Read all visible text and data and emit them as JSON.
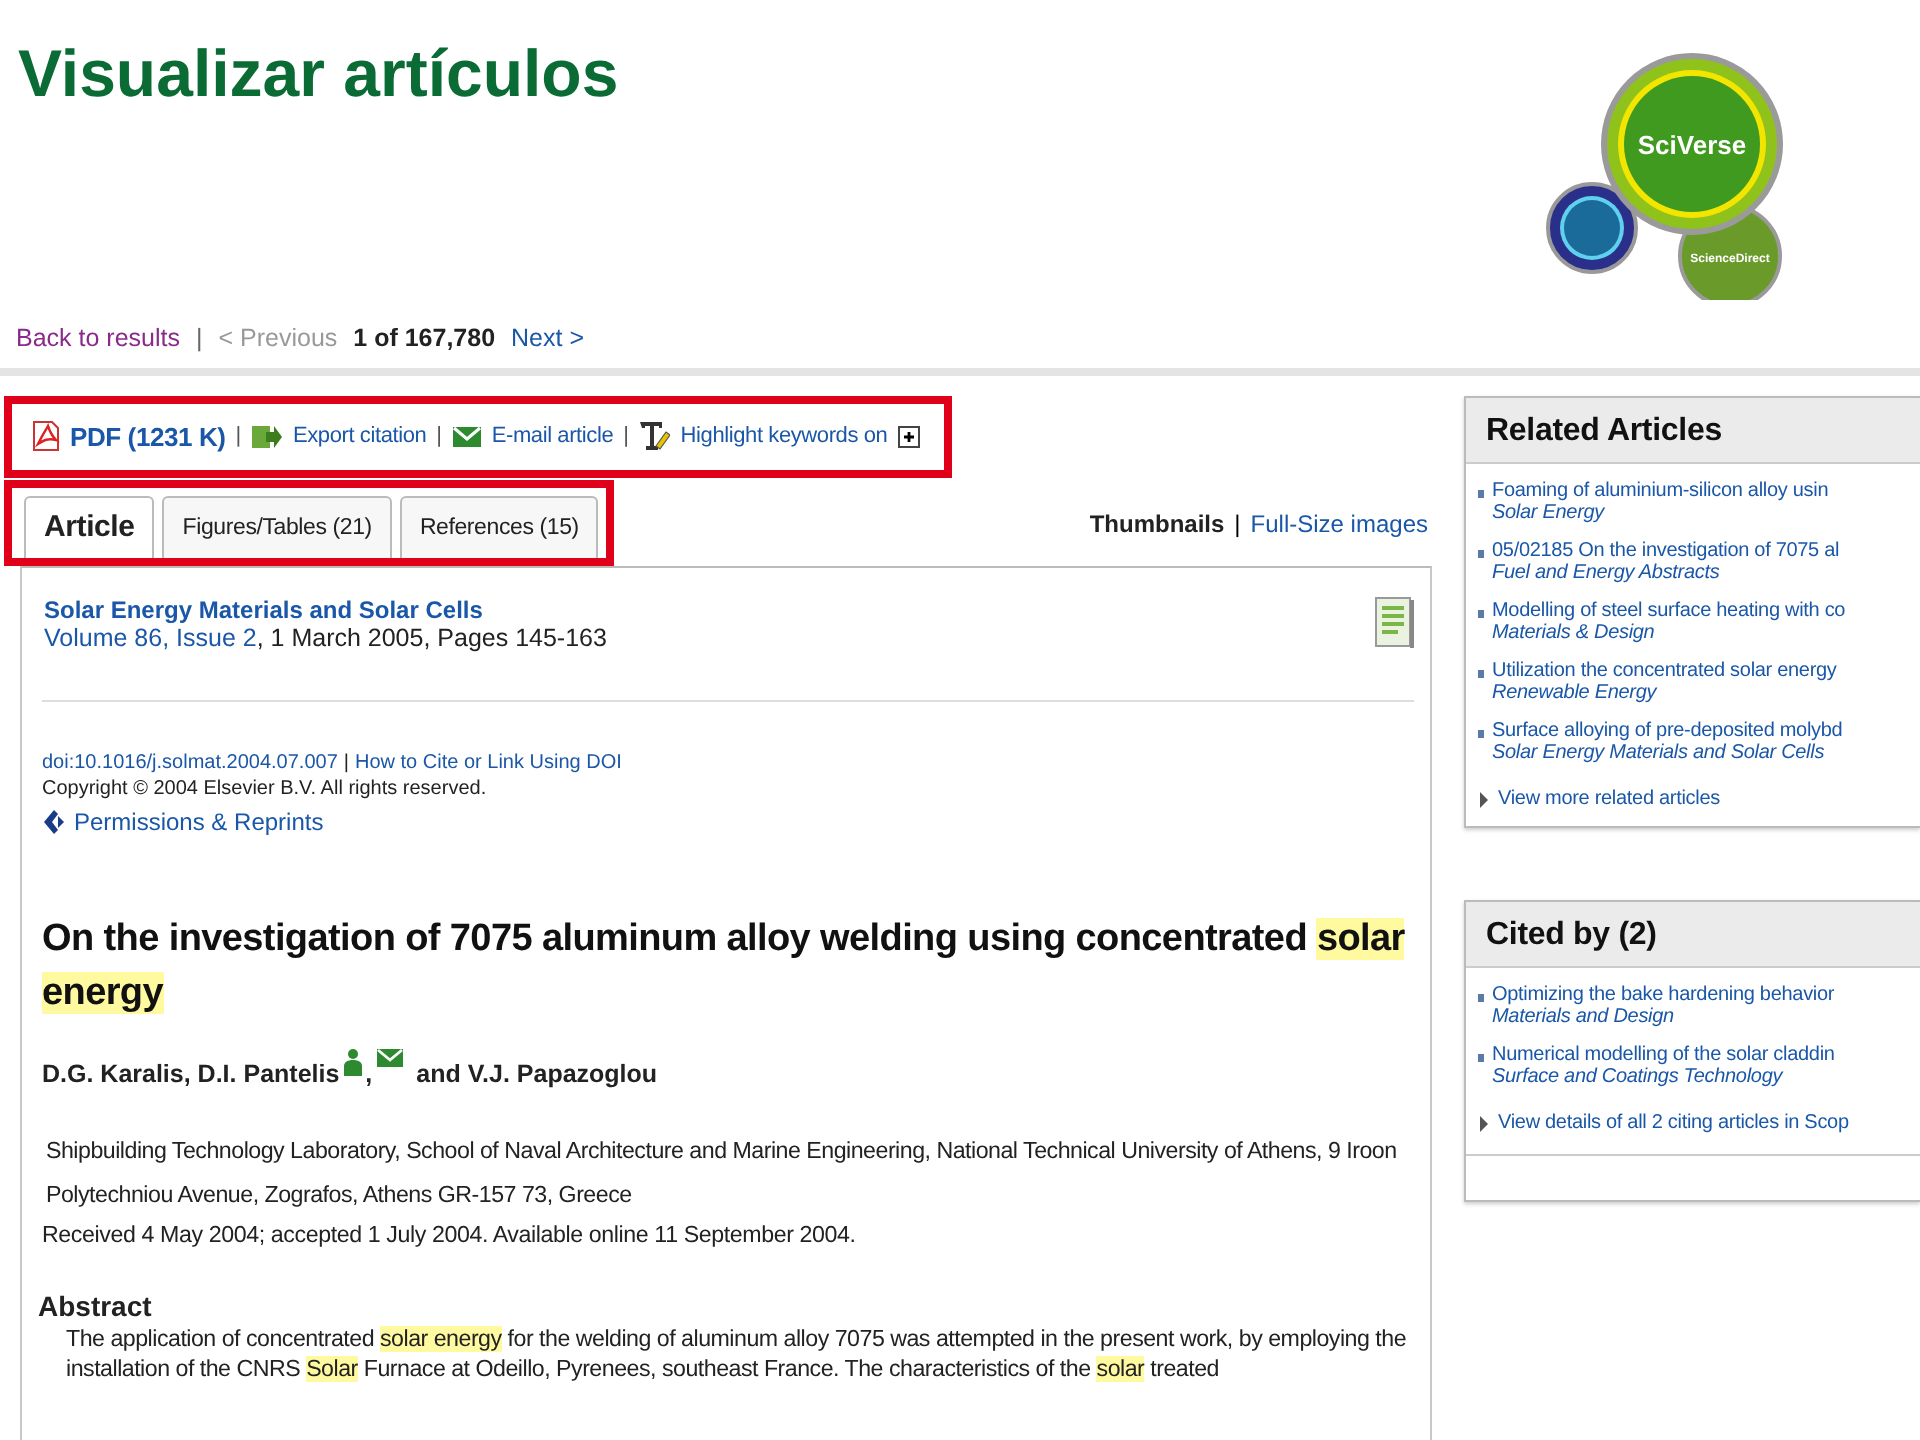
{
  "slide_title": "Visualizar artículos",
  "logo": {
    "main": "SciVerse",
    "secondary": "ScienceDirect"
  },
  "nav": {
    "back": "Back to results",
    "separator": "|",
    "previous": "< Previous",
    "previous_disabled": true,
    "position": "1 of 167,780",
    "next": "Next >"
  },
  "toolbar": {
    "outlined": true,
    "items": [
      {
        "kind": "pdf",
        "label": "PDF (1231 K)",
        "separator": "|"
      },
      {
        "kind": "export",
        "label": "Export citation",
        "separator": "|"
      },
      {
        "kind": "email",
        "label": "E-mail article",
        "separator": "|"
      },
      {
        "kind": "highlight",
        "label": "Highlight keywords on"
      }
    ]
  },
  "tabs": {
    "outlined": true,
    "items": [
      {
        "label": "Article",
        "selected": true
      },
      {
        "label": "Figures/Tables (21)",
        "selected": false
      },
      {
        "label": "References (15)",
        "selected": false
      }
    ]
  },
  "image_view": {
    "current": "Thumbnails",
    "separator": "|",
    "link": "Full-Size images"
  },
  "article": {
    "journal": "Solar Energy Materials and Solar Cells",
    "volume_link": "Volume 86, Issue 2",
    "volume_rest": ", 1 March 2005, Pages 145-163",
    "doi": "doi:10.1016/j.solmat.2004.07.007",
    "doi_separator": "|",
    "cite_link": "How to Cite or Link Using DOI",
    "copyright": "Copyright © 2004 Elsevier B.V. All rights reserved.",
    "permissions": "Permissions & Reprints",
    "title": [
      {
        "text": "On the investigation of 7075 aluminum alloy welding using concentrated ",
        "highlighted": false
      },
      {
        "text": "solar energy",
        "highlighted": true
      }
    ],
    "authors_first": "D.G. Karalis, D.I. Pantelis",
    "authors_comma": ",",
    "authors_last": "and V.J. Papazoglou",
    "affiliation": "Shipbuilding Technology Laboratory, School of Naval Architecture and Marine Engineering, National Technical University of Athens, 9 Iroon Polytechniou Avenue, Zografos, Athens GR-157 73, Greece",
    "dates": "Received 4 May 2004;  accepted 1 July 2004.  Available online 11 September 2004.",
    "abstract_heading": "Abstract",
    "abstract": [
      {
        "text": "The application of concentrated ",
        "highlighted": false
      },
      {
        "text": "solar energy",
        "highlighted": true
      },
      {
        "text": " for the welding of aluminum alloy 7075 was attempted in the present work, by employing the installation of the CNRS ",
        "highlighted": false
      },
      {
        "text": "Solar",
        "highlighted": true
      },
      {
        "text": " Furnace at Odeillo, Pyrenees, southeast France. The characteristics of the ",
        "highlighted": false
      },
      {
        "text": "solar",
        "highlighted": true
      },
      {
        "text": " treated",
        "highlighted": false
      }
    ]
  },
  "panels": [
    {
      "heading": "Related Articles",
      "items": [
        {
          "title": "Foaming of aluminium-silicon alloy usin",
          "source": "Solar Energy"
        },
        {
          "title": "05/02185 On the investigation of 7075 al",
          "source": "Fuel and Energy Abstracts"
        },
        {
          "title": "Modelling of steel surface heating with co",
          "source": "Materials & Design"
        },
        {
          "title": "Utilization the concentrated solar energy",
          "source": "Renewable Energy"
        },
        {
          "title": "Surface alloying of pre-deposited molybd",
          "source": "Solar Energy Materials and Solar Cells"
        }
      ],
      "more": "View more related articles"
    },
    {
      "heading": "Cited by (2)",
      "items": [
        {
          "title": "Optimizing the bake hardening behavior",
          "source": "Materials and Design"
        },
        {
          "title": "Numerical modelling of the solar claddin",
          "source": "Surface and Coatings Technology"
        }
      ],
      "more": "View details of all 2 citing articles in Scop"
    }
  ]
}
